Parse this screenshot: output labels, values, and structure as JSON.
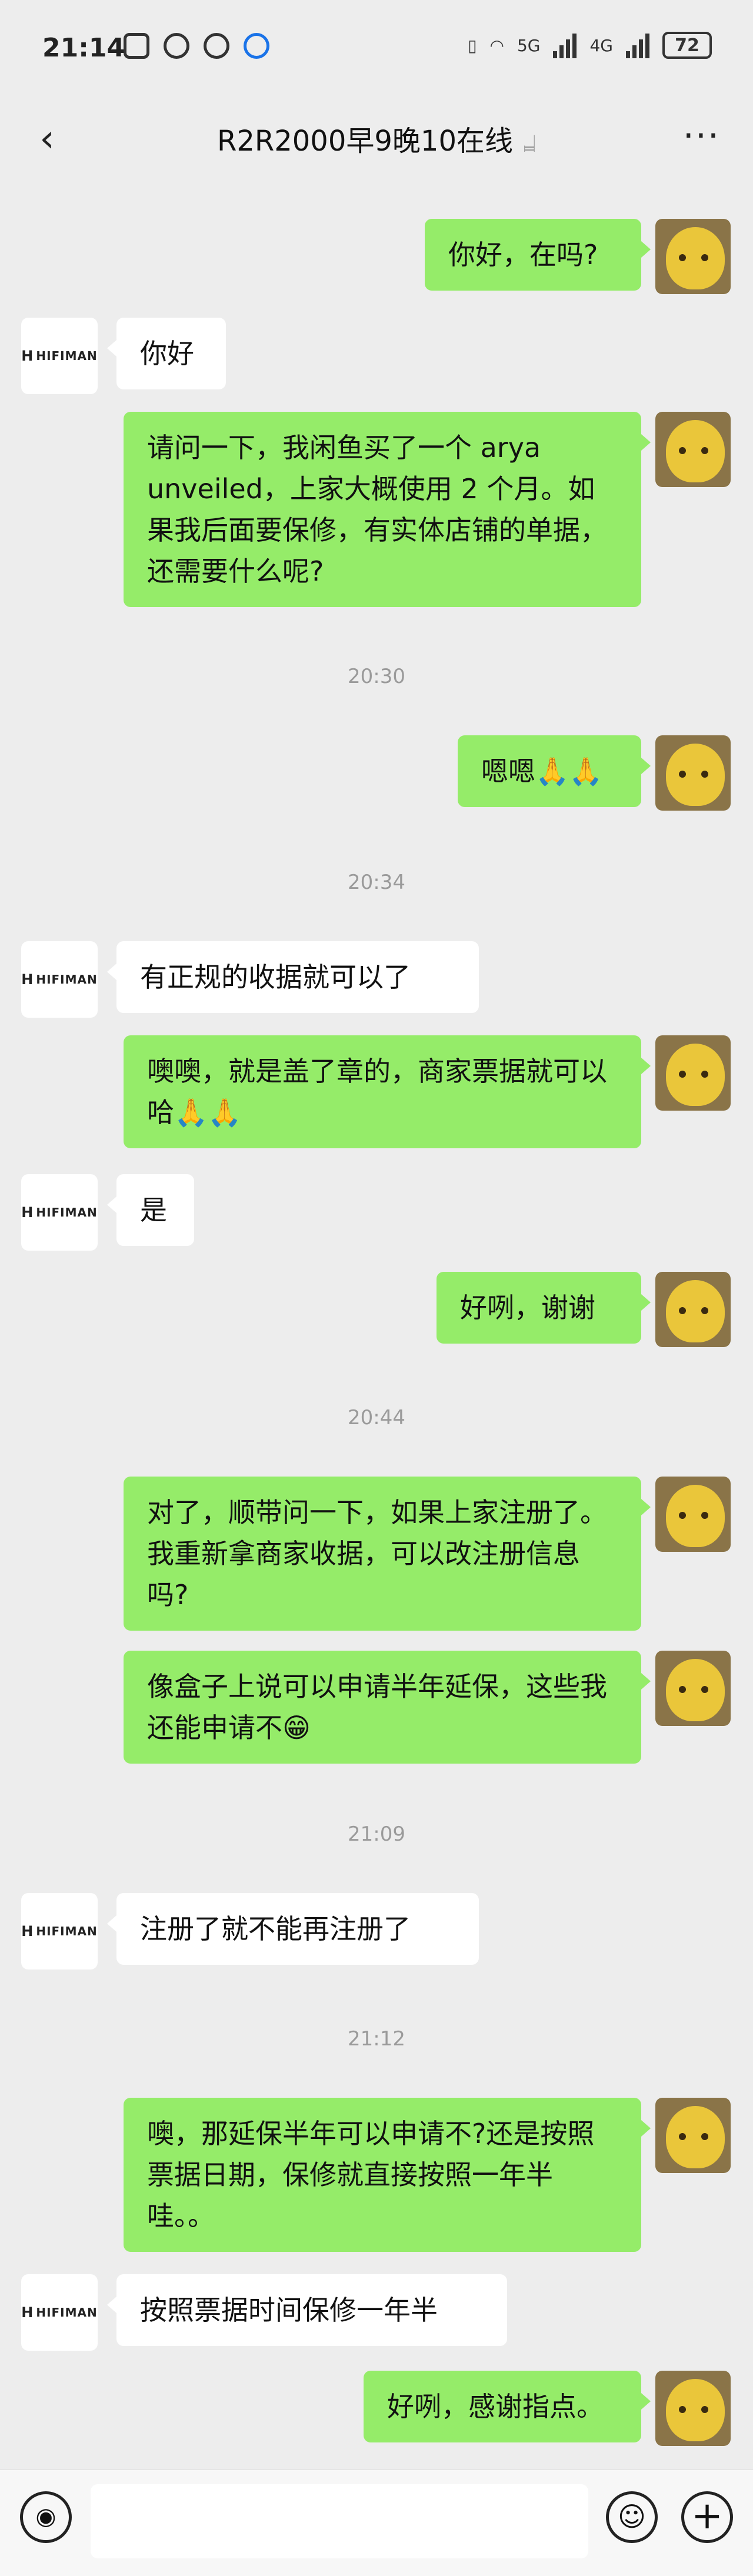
{
  "status": {
    "time": "21:14",
    "net1": "5G",
    "net2": "4G",
    "battery": "72"
  },
  "header": {
    "title": "R2R2000早9晚10在线",
    "ear_icon": "ear-icon",
    "more_icon": "more-icon",
    "back_icon": "back-arrow-icon"
  },
  "them_avatar": {
    "mark": "H",
    "label": "HIFIMAN"
  },
  "messages": [
    {
      "from": "me",
      "text": "你好，在吗?"
    },
    {
      "from": "them",
      "text": "你好"
    },
    {
      "from": "me",
      "text": "请问一下，我闲鱼买了一个 arya unveiled，上家大概使用 2 个月。如果我后面要保修，有实体店铺的单据，还需要什么呢?"
    },
    {
      "time": "20:30"
    },
    {
      "from": "me",
      "text": "嗯嗯🙏🙏"
    },
    {
      "time": "20:34"
    },
    {
      "from": "them",
      "text": "有正规的收据就可以了"
    },
    {
      "from": "me",
      "text": "噢噢，就是盖了章的，商家票据就可以哈🙏🙏"
    },
    {
      "from": "them",
      "text": "是"
    },
    {
      "from": "me",
      "text": "好咧，谢谢"
    },
    {
      "time": "20:44"
    },
    {
      "from": "me",
      "text": "对了，顺带问一下，如果上家注册了。我重新拿商家收据，可以改注册信息吗?"
    },
    {
      "from": "me",
      "text": "像盒子上说可以申请半年延保，这些我还能申请不😁"
    },
    {
      "time": "21:09"
    },
    {
      "from": "them",
      "text": "注册了就不能再注册了"
    },
    {
      "time": "21:12"
    },
    {
      "from": "me",
      "text": "噢，那延保半年可以申请不?还是按照票据日期，保修就直接按照一年半哇。。"
    },
    {
      "from": "them",
      "text": "按照票据时间保修一年半"
    },
    {
      "from": "me",
      "text": "好咧，感谢指点。"
    }
  ],
  "input": {
    "placeholder": ""
  },
  "icons": {
    "voice": "voice-icon",
    "emoji": "emoji-icon",
    "plus": "plus-icon"
  }
}
